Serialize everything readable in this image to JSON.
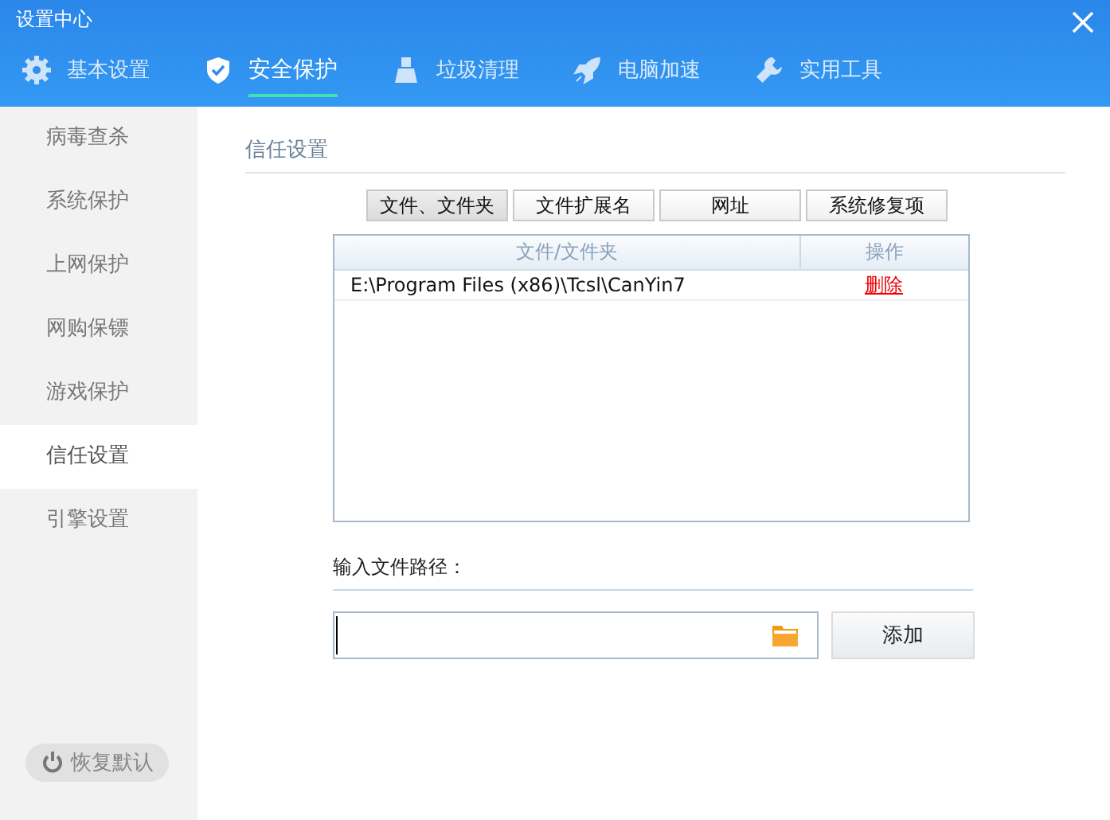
{
  "window": {
    "title": "设置中心"
  },
  "tabs": [
    {
      "label": "基本设置",
      "selected": false
    },
    {
      "label": "安全保护",
      "selected": true
    },
    {
      "label": "垃圾清理",
      "selected": false
    },
    {
      "label": "电脑加速",
      "selected": false
    },
    {
      "label": "实用工具",
      "selected": false
    }
  ],
  "sidebar": {
    "items": [
      {
        "label": "病毒查杀",
        "selected": false
      },
      {
        "label": "系统保护",
        "selected": false
      },
      {
        "label": "上网保护",
        "selected": false
      },
      {
        "label": "网购保镖",
        "selected": false
      },
      {
        "label": "游戏保护",
        "selected": false
      },
      {
        "label": "信任设置",
        "selected": true
      },
      {
        "label": "引擎设置",
        "selected": false
      }
    ],
    "restore_button": "恢复默认"
  },
  "section_title": "信任设置",
  "sub_tabs": [
    {
      "label": "文件、文件夹",
      "selected": true
    },
    {
      "label": "文件扩展名",
      "selected": false
    },
    {
      "label": "网址",
      "selected": false
    },
    {
      "label": "系统修复项",
      "selected": false
    }
  ],
  "table": {
    "columns": [
      "文件/文件夹",
      "操作"
    ],
    "rows": [
      {
        "path": "E:\\Program Files (x86)\\Tcsl\\CanYin7",
        "action": "删除"
      }
    ]
  },
  "path_label": "输入文件路径：",
  "add_button": "添加"
}
